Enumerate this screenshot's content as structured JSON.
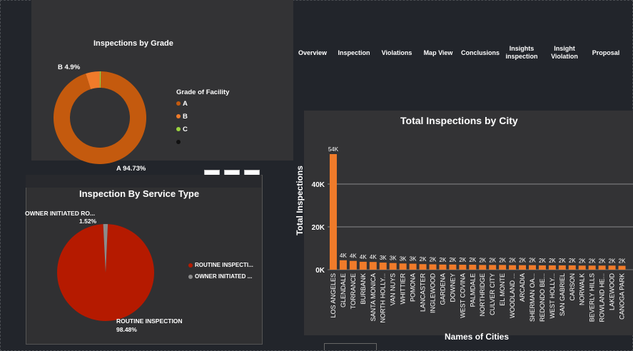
{
  "nav": [
    {
      "label": "Overview"
    },
    {
      "label": "Inspection"
    },
    {
      "label": "Violations"
    },
    {
      "label": "Map View"
    },
    {
      "label": "Conclusions"
    },
    {
      "label": "Insights inspection"
    },
    {
      "label": "Insight Violation"
    },
    {
      "label": "Proposal"
    }
  ],
  "grade_chart": {
    "title": "Inspections by Grade",
    "legend_title": "Grade of Facility",
    "legend": [
      {
        "label": "A",
        "color": "#c45a0e"
      },
      {
        "label": "B",
        "color": "#f07b2a"
      },
      {
        "label": "C",
        "color": "#9bd33f"
      },
      {
        "label": "",
        "color": "#1a1a1a"
      }
    ],
    "label_a": "A 94.73%",
    "label_b": "B 4.9%"
  },
  "service_chart": {
    "title": "Inspection By Service Type",
    "label_owner_name": "OWNER INITIATED RO...",
    "label_owner_pct": "1.52%",
    "label_routine_name": "ROUTINE INSPECTION",
    "label_routine_pct": "98.48%",
    "legend": [
      {
        "label": "ROUTINE INSPECTI...",
        "color": "#b51a00"
      },
      {
        "label": "OWNER INITIATED ...",
        "color": "#8c8c8c"
      }
    ]
  },
  "toolbar": {
    "filter_icon": "filter-icon",
    "focus_icon": "focus-mode-icon",
    "more_icon": "more-options-icon"
  },
  "city_chart": {
    "title": "Total Inspections by City",
    "xlabel": "Names of Cities",
    "ylabel": "Total Inspections",
    "y_ticks": [
      "0K",
      "20K",
      "40K"
    ]
  },
  "chart_data": [
    {
      "type": "pie",
      "title": "Inspections by Grade",
      "donut": true,
      "legend_title": "Grade of Facility",
      "categories": [
        "A",
        "B",
        "C"
      ],
      "values": [
        94.73,
        4.9,
        0.37
      ],
      "colors": [
        "#c45a0e",
        "#f07b2a",
        "#9bd33f"
      ]
    },
    {
      "type": "pie",
      "title": "Inspection By Service Type",
      "categories": [
        "ROUTINE INSPECTION",
        "OWNER INITIATED RO..."
      ],
      "values": [
        98.48,
        1.52
      ],
      "colors": [
        "#b51a00",
        "#8c8c8c"
      ]
    },
    {
      "type": "bar",
      "title": "Total Inspections by City",
      "xlabel": "Names of Cities",
      "ylabel": "Total Inspections",
      "ylim": [
        0,
        62000
      ],
      "grid": true,
      "categories": [
        "LOS ANGELES",
        "GLENDALE",
        "TORRANCE",
        "BURBANK",
        "SANTA MONICA",
        "NORTH HOLLY...",
        "VAN NUYS",
        "WHITTIER",
        "POMONA",
        "LANCASTER",
        "INGLEWOOD",
        "GARDENA",
        "DOWNEY",
        "WEST COVINA",
        "PALMDALE",
        "NORTHRIDGE",
        "CULVER CITY",
        "EL MONTE",
        "WOODLAND ...",
        "ARCADIA",
        "SHERMAN OA...",
        "REDONDO BE...",
        "WEST HOLLY...",
        "SAN GABRIEL",
        "CARSON",
        "NORWALK",
        "BEVERLY HILLS",
        "ROWLAND HE...",
        "LAKEWOOD",
        "CANOGA PARK"
      ],
      "values": [
        54000,
        4400,
        4100,
        3700,
        3600,
        3300,
        3100,
        2900,
        2800,
        2600,
        2500,
        2400,
        2400,
        2300,
        2300,
        2200,
        2200,
        2200,
        2100,
        2100,
        2100,
        2000,
        2000,
        2000,
        2000,
        1900,
        1900,
        1900,
        1900,
        1800
      ],
      "data_labels": [
        "54K",
        "4K",
        "4K",
        "4K",
        "4K",
        "3K",
        "3K",
        "3K",
        "3K",
        "2K",
        "2K",
        "2K",
        "2K",
        "2K",
        "2K",
        "2K",
        "2K",
        "2K",
        "2K",
        "2K",
        "2K",
        "2K",
        "2K",
        "2K",
        "2K",
        "2K",
        "2K",
        "2K",
        "2K",
        "2K"
      ],
      "color": "#f07b2a"
    }
  ]
}
